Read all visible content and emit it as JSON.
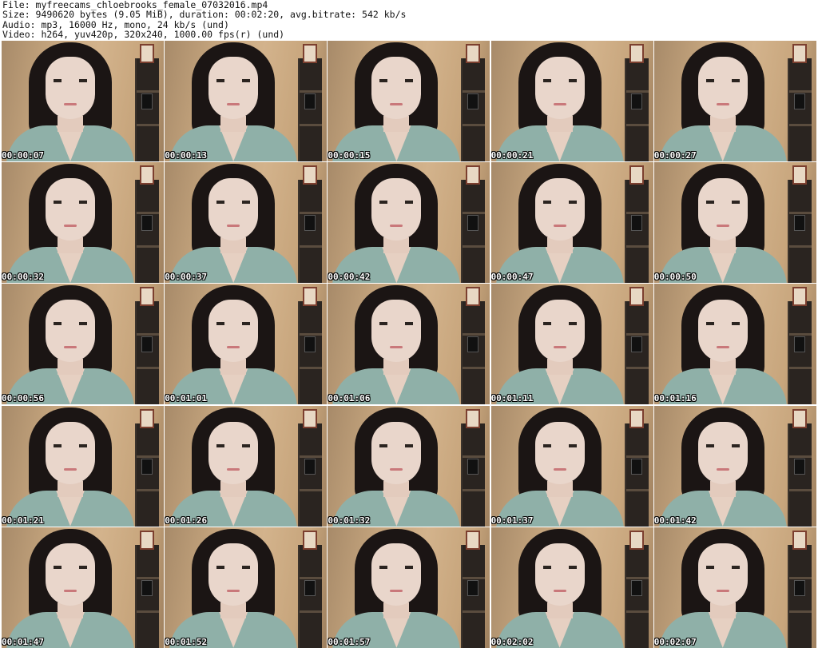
{
  "header": {
    "line1": "File: myfreecams_chloebrooks_female_07032016.mp4",
    "line2": "Size: 9490620 bytes (9.05 MiB), duration: 00:02:20, avg.bitrate: 542 kb/s",
    "line3": "Audio: mp3, 16000 Hz, mono, 24 kb/s (und)",
    "line4": "Video: h264, yuv420p, 320x240, 1000.00 fps(r) (und)"
  },
  "colors": {
    "background": "#ffffff",
    "wall": "#c4a47d",
    "shirt": "#8fb0a8",
    "timestamp": "#ffffff"
  },
  "timestamps": [
    "00:00:07",
    "00:00:13",
    "00:00:15",
    "00:00:21",
    "00:00:27",
    "00:00:32",
    "00:00:37",
    "00:00:42",
    "00:00:47",
    "00:00:50",
    "00:00:56",
    "00:01:01",
    "00:01:06",
    "00:01:11",
    "00:01:16",
    "00:01:21",
    "00:01:26",
    "00:01:32",
    "00:01:37",
    "00:01:42",
    "00:01:47",
    "00:01:52",
    "00:01:57",
    "00:02:02",
    "00:02:07"
  ]
}
